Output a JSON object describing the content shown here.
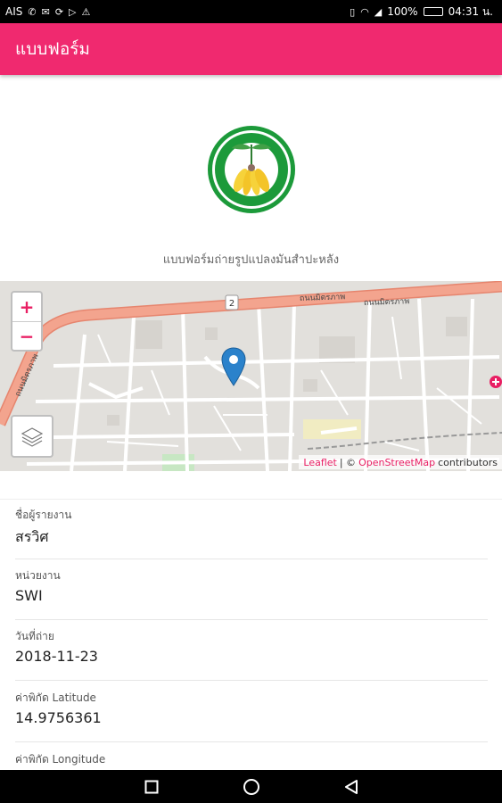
{
  "status_bar": {
    "carrier": "AIS",
    "battery": "100%",
    "battery_level": 1.0,
    "time": "04:31 น."
  },
  "app_bar": {
    "title": "แบบฟอร์ม"
  },
  "form": {
    "subtitle": "แบบฟอร์มถ่ายรูปแปลงมันสำปะหลัง"
  },
  "map": {
    "zoom_in": "+",
    "zoom_out": "−",
    "road_label_1": "ถนนมิตรภาพ",
    "road_label_2": "ถนนมิตรภาพ",
    "road_label_3": "ถนนมิตรภาพ",
    "route_number": "2",
    "attribution": {
      "leaflet": "Leaflet",
      "separator": "| ©",
      "osm": "OpenStreetMap",
      "contributors": "contributors"
    },
    "colors": {
      "major_road": "#f3a48e",
      "land": "#e2e0dc",
      "marker": "#2b82cb"
    }
  },
  "fields": [
    {
      "label": "ชื่อผู้รายงาน",
      "value": "สรวิศ"
    },
    {
      "label": "หน่วยงาน",
      "value": "SWI"
    },
    {
      "label": "วันที่ถ่าย",
      "value": "2018-11-23"
    },
    {
      "label": "ค่าพิกัด Latitude",
      "value": "14.9756361"
    },
    {
      "label": "ค่าพิกัด Longitude",
      "value": ""
    }
  ],
  "colors": {
    "accent": "#f0296f",
    "link": "#e91e63"
  }
}
